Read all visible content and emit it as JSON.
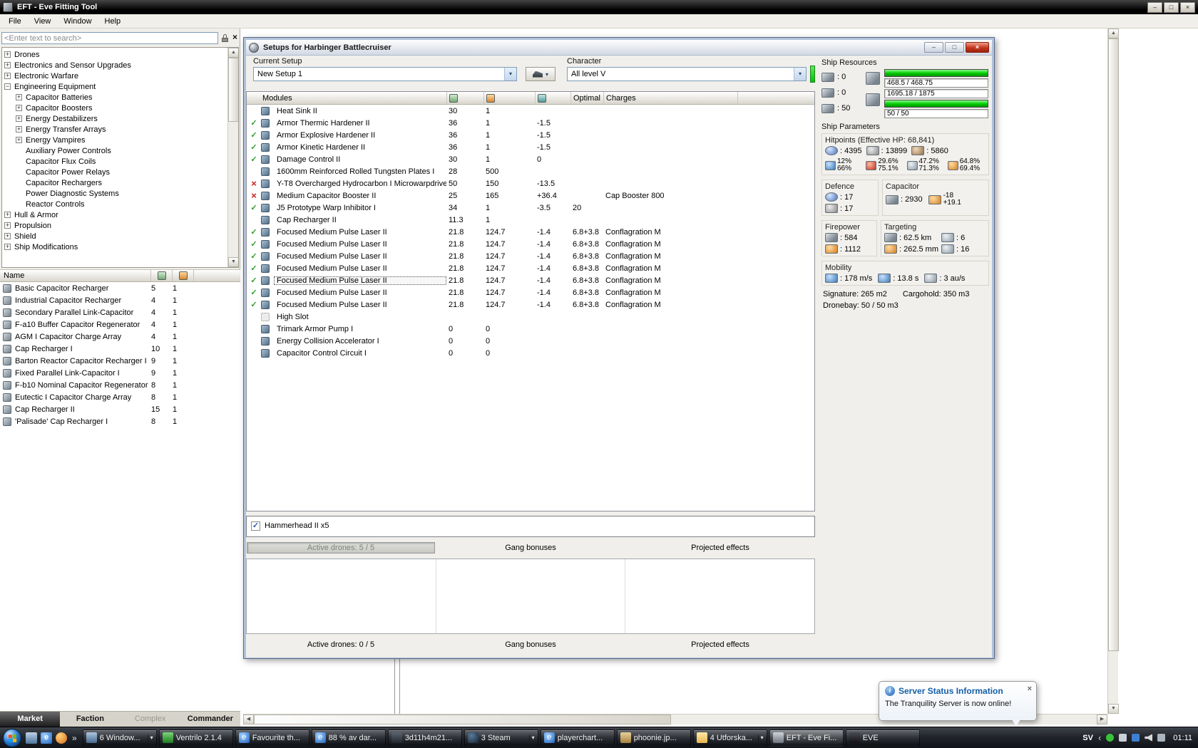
{
  "colors": {
    "accent_green": "#00c800",
    "status_ok": "#2e9e2e",
    "status_err": "#cc2020",
    "balloon_title_blue": "#1560a8"
  },
  "titlebar": {
    "title": "EFT - Eve Fitting Tool"
  },
  "menubar": {
    "items": [
      "File",
      "View",
      "Window",
      "Help"
    ]
  },
  "sidebar": {
    "search_value": "<Enter text to search>",
    "tree": [
      {
        "label": "Drones",
        "lvl": "lvl0",
        "tg": "plus"
      },
      {
        "label": "Electronics and Sensor Upgrades",
        "lvl": "lvl0",
        "tg": "plus"
      },
      {
        "label": "Electronic Warfare",
        "lvl": "lvl0",
        "tg": "plus"
      },
      {
        "label": "Engineering Equipment",
        "lvl": "lvl0",
        "tg": "minus"
      },
      {
        "label": "Capacitor Batteries",
        "lvl": "lvl1",
        "tg": "plus"
      },
      {
        "label": "Capacitor Boosters",
        "lvl": "lvl1",
        "tg": "plus"
      },
      {
        "label": "Energy Destabilizers",
        "lvl": "lvl1",
        "tg": "plus"
      },
      {
        "label": "Energy Transfer Arrays",
        "lvl": "lvl1",
        "tg": "plus"
      },
      {
        "label": "Energy Vampires",
        "lvl": "lvl1",
        "tg": "plus"
      },
      {
        "label": "Auxiliary Power Controls",
        "lvl": "lvl1",
        "tg": "leaf"
      },
      {
        "label": "Capacitor Flux Coils",
        "lvl": "lvl1",
        "tg": "leaf"
      },
      {
        "label": "Capacitor Power Relays",
        "lvl": "lvl1",
        "tg": "leaf"
      },
      {
        "label": "Capacitor Rechargers",
        "lvl": "lvl1",
        "tg": "leaf"
      },
      {
        "label": "Power Diagnostic Systems",
        "lvl": "lvl1",
        "tg": "leaf"
      },
      {
        "label": "Reactor Controls",
        "lvl": "lvl1",
        "tg": "leaf"
      },
      {
        "label": "Hull & Armor",
        "lvl": "lvl0",
        "tg": "plus"
      },
      {
        "label": "Propulsion",
        "lvl": "lvl0",
        "tg": "plus"
      },
      {
        "label": "Shield",
        "lvl": "lvl0",
        "tg": "plus"
      },
      {
        "label": "Ship Modifications",
        "lvl": "lvl0",
        "tg": "plus"
      }
    ],
    "results": {
      "name_header": "Name",
      "rows": [
        {
          "name": "Basic Capacitor Recharger",
          "m1": "5",
          "m2": "1"
        },
        {
          "name": "Industrial Capacitor Recharger",
          "m1": "4",
          "m2": "1"
        },
        {
          "name": "Secondary Parallel Link-Capacitor",
          "m1": "4",
          "m2": "1"
        },
        {
          "name": "F-a10 Buffer Capacitor Regenerator",
          "m1": "4",
          "m2": "1"
        },
        {
          "name": "AGM I Capacitor Charge Array",
          "m1": "4",
          "m2": "1"
        },
        {
          "name": "Cap Recharger I",
          "m1": "10",
          "m2": "1"
        },
        {
          "name": "Barton Reactor Capacitor Recharger I",
          "m1": "9",
          "m2": "1"
        },
        {
          "name": "Fixed Parallel Link-Capacitor I",
          "m1": "9",
          "m2": "1"
        },
        {
          "name": "F-b10 Nominal Capacitor Regenerator",
          "m1": "8",
          "m2": "1"
        },
        {
          "name": "Eutectic I Capacitor Charge Array",
          "m1": "8",
          "m2": "1"
        },
        {
          "name": "Cap Recharger II",
          "m1": "15",
          "m2": "1"
        },
        {
          "name": "'Palisade' Cap Recharger I",
          "m1": "8",
          "m2": "1"
        }
      ]
    },
    "tabs": [
      {
        "label": "Market",
        "state": "selected"
      },
      {
        "label": "Faction",
        "state": ""
      },
      {
        "label": "Complex",
        "state": "disabled"
      },
      {
        "label": "Commander",
        "state": ""
      }
    ]
  },
  "setup_window": {
    "title": "Setups for Harbinger Battlecruiser",
    "current_setup_label": "Current Setup",
    "current_setup_value": "New Setup 1",
    "character_label": "Character",
    "character_value": "All level V",
    "modules_header": {
      "modules": "Modules",
      "optimal": "Optimal",
      "charges": "Charges"
    },
    "modules": [
      {
        "status": "none",
        "icon": "heat-sink-icon",
        "name": "Heat Sink II",
        "cpu": "30",
        "pg": "1"
      },
      {
        "status": "ok",
        "icon": "armor-hardener-icon",
        "name": "Armor Thermic Hardener II",
        "cpu": "36",
        "pg": "1",
        "cap": "-1.5"
      },
      {
        "status": "ok",
        "icon": "armor-hardener-icon",
        "name": "Armor Explosive Hardener II",
        "cpu": "36",
        "pg": "1",
        "cap": "-1.5"
      },
      {
        "status": "ok",
        "icon": "armor-hardener-icon",
        "name": "Armor Kinetic Hardener II",
        "cpu": "36",
        "pg": "1",
        "cap": "-1.5"
      },
      {
        "status": "ok",
        "icon": "damage-control-icon",
        "name": "Damage Control II",
        "cpu": "30",
        "pg": "1",
        "cap": "0"
      },
      {
        "status": "none",
        "icon": "armor-plate-icon",
        "name": "1600mm Reinforced Rolled Tungsten Plates I",
        "cpu": "28",
        "pg": "500"
      },
      {
        "status": "err",
        "icon": "microwarpdrive-icon",
        "name": "Y-T8 Overcharged Hydrocarbon I Microwarpdrive",
        "cpu": "50",
        "pg": "150",
        "cap": "-13.5"
      },
      {
        "status": "err",
        "icon": "cap-booster-icon",
        "name": "Medium Capacitor Booster II",
        "cpu": "25",
        "pg": "165",
        "cap": "+36.4",
        "charges": "Cap Booster 800"
      },
      {
        "status": "ok",
        "icon": "warp-disruptor-icon",
        "name": "J5 Prototype Warp Inhibitor I",
        "cpu": "34",
        "pg": "1",
        "cap": "-3.5",
        "optimal": "20"
      },
      {
        "status": "none",
        "icon": "cap-recharger-icon",
        "name": "Cap Recharger II",
        "cpu": "11.3",
        "pg": "1"
      },
      {
        "status": "ok",
        "icon": "pulse-laser-icon",
        "name": "Focused Medium Pulse Laser II",
        "cpu": "21.8",
        "pg": "124.7",
        "cap": "-1.4",
        "optimal": "6.8+3.8",
        "charges": "Conflagration M"
      },
      {
        "status": "ok",
        "icon": "pulse-laser-icon",
        "name": "Focused Medium Pulse Laser II",
        "cpu": "21.8",
        "pg": "124.7",
        "cap": "-1.4",
        "optimal": "6.8+3.8",
        "charges": "Conflagration M"
      },
      {
        "status": "ok",
        "icon": "pulse-laser-icon",
        "name": "Focused Medium Pulse Laser II",
        "cpu": "21.8",
        "pg": "124.7",
        "cap": "-1.4",
        "optimal": "6.8+3.8",
        "charges": "Conflagration M"
      },
      {
        "status": "ok",
        "icon": "pulse-laser-icon",
        "name": "Focused Medium Pulse Laser II",
        "cpu": "21.8",
        "pg": "124.7",
        "cap": "-1.4",
        "optimal": "6.8+3.8",
        "charges": "Conflagration M"
      },
      {
        "status": "ok",
        "icon": "pulse-laser-icon",
        "name": "Focused Medium Pulse Laser II",
        "cpu": "21.8",
        "pg": "124.7",
        "cap": "-1.4",
        "optimal": "6.8+3.8",
        "charges": "Conflagration M",
        "state": "selected"
      },
      {
        "status": "ok",
        "icon": "pulse-laser-icon",
        "name": "Focused Medium Pulse Laser II",
        "cpu": "21.8",
        "pg": "124.7",
        "cap": "-1.4",
        "optimal": "6.8+3.8",
        "charges": "Conflagration M"
      },
      {
        "status": "ok",
        "icon": "pulse-laser-icon",
        "name": "Focused Medium Pulse Laser II",
        "cpu": "21.8",
        "pg": "124.7",
        "cap": "-1.4",
        "optimal": "6.8+3.8",
        "charges": "Conflagration M"
      },
      {
        "status": "none",
        "icon": "empty-slot-icon",
        "name": "High Slot"
      },
      {
        "status": "none",
        "icon": "rig-icon",
        "name": "Trimark Armor Pump I",
        "cpu": "0",
        "pg": "0"
      },
      {
        "status": "none",
        "icon": "rig-icon",
        "name": "Energy Collision Accelerator I",
        "cpu": "0",
        "pg": "0"
      },
      {
        "status": "none",
        "icon": "rig-icon",
        "name": "Capacitor Control Circuit I",
        "cpu": "0",
        "pg": "0"
      }
    ],
    "drones": [
      {
        "label": "Hammerhead II x5"
      }
    ],
    "panel_headers": {
      "active_drones_bar": "Active drones: 5 / 5",
      "gang": "Gang bonuses",
      "projected": "Projected effects"
    },
    "footer": {
      "active_drones": "Active drones: 0 / 5",
      "gang": "Gang bonuses",
      "projected": "Projected effects"
    }
  },
  "stats": {
    "resources_title": "Ship Resources",
    "turrets": ": 0",
    "launchers": ": 0",
    "rigs": ": 50",
    "powergrid": "468.5 / 468.75",
    "cpu": "1695.18 / 1875",
    "calibration": "50 / 50",
    "parameters_title": "Ship Parameters",
    "hitpoints_title": "Hitpoints (Effective HP: 68,841)",
    "shield_hp": ": 4395",
    "armor_hp": ": 13899",
    "hull_hp": ": 5860",
    "resists": [
      {
        "type": "em",
        "shield": "12%",
        "armor": "66%"
      },
      {
        "type": "thermal",
        "shield": "29.6%",
        "armor": "75.1%"
      },
      {
        "type": "kinetic",
        "shield": "47.2%",
        "armor": "71.3%"
      },
      {
        "type": "explosive",
        "shield": "64.8%",
        "armor": "69.4%"
      }
    ],
    "defence_title": "Defence",
    "defence1": ": 17",
    "defence2": ": 17",
    "capacitor_title": "Capacitor",
    "capacitor_amount": ": 2930",
    "capacitor_drain": "-18",
    "capacitor_recharge": "+19.1",
    "firepower_title": "Firepower",
    "firepower_dps": ": 584",
    "firepower_volley": ": 1112",
    "targeting_title": "Targeting",
    "targeting_range": ": 62.5 km",
    "targeting_max": ": 6",
    "targeting_resolution": ": 262.5 mm",
    "targeting_sensor": ": 16",
    "mobility_title": "Mobility",
    "mobility_speed": ": 178 m/s",
    "mobility_align": ": 13.8 s",
    "mobility_warp": ": 3 au/s",
    "signature": "Signature: 265 m2",
    "cargohold": "Cargohold: 350 m3",
    "dronebay": "Dronebay: 50 / 50 m3"
  },
  "notification": {
    "title": "Server Status Information",
    "body": "The Tranquility Server is now online!"
  },
  "taskbar": {
    "buttons": [
      {
        "label": "6 Window...",
        "icon": "windows-group-icon",
        "state": "grouped"
      },
      {
        "label": "Ventrilo 2.1.4",
        "icon": "ventrilo-icon",
        "state": ""
      },
      {
        "label": "Favourite th...",
        "icon": "ie-icon",
        "state": ""
      },
      {
        "label": "88 % av dar...",
        "icon": "ie-icon",
        "state": ""
      },
      {
        "label": "3d11h4m21...",
        "icon": "timer-icon",
        "state": ""
      },
      {
        "label": "3 Steam",
        "icon": "steam-icon",
        "state": "grouped"
      },
      {
        "label": "playerchart...",
        "icon": "ie-icon",
        "state": ""
      },
      {
        "label": "phoonie.jp...",
        "icon": "image-icon",
        "state": ""
      },
      {
        "label": "4 Utforska...",
        "icon": "folder-icon",
        "state": "grouped"
      },
      {
        "label": "EFT - Eve Fi...",
        "icon": "eft-icon",
        "state": "active"
      },
      {
        "label": "EVE",
        "icon": "eve-icon",
        "state": ""
      }
    ],
    "tray": {
      "lang": "SV",
      "clock": "01:11"
    }
  }
}
